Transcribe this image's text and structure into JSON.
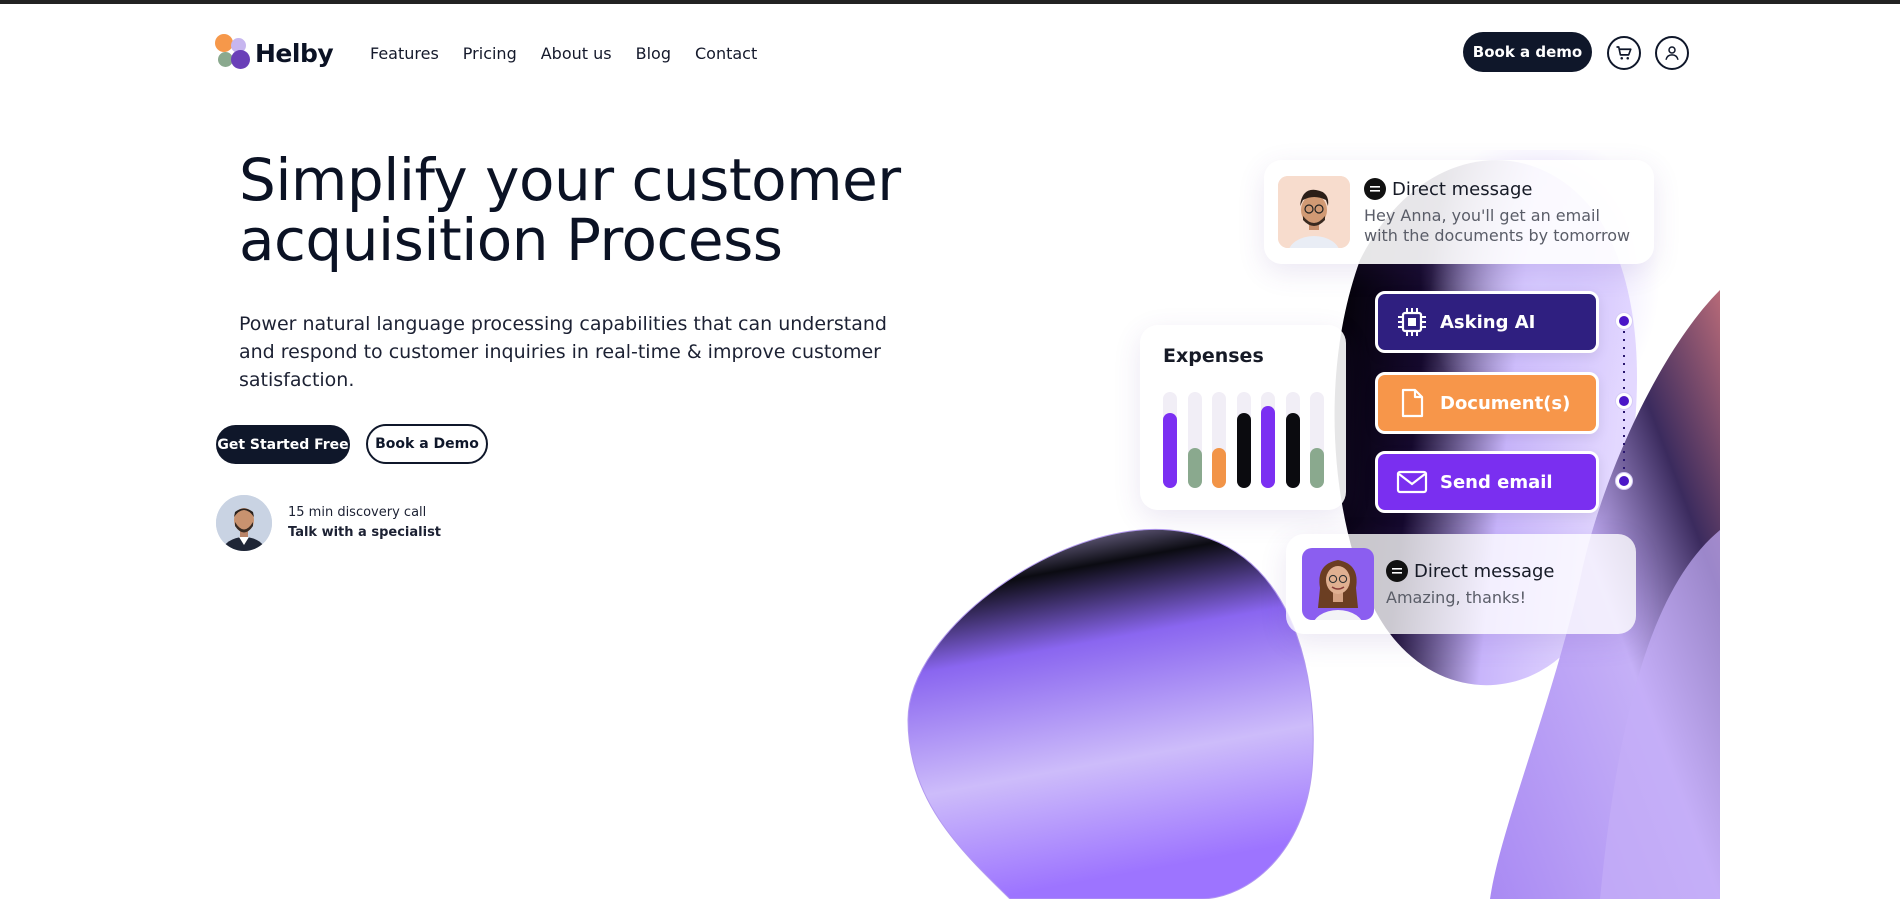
{
  "brand": {
    "name": "Helby",
    "colors": {
      "orange": "#f6984a",
      "lavender": "#c7b6ef",
      "sage": "#8aa98e",
      "purple": "#6a3fb8"
    }
  },
  "nav": {
    "links": [
      "Features",
      "Pricing",
      "About us",
      "Blog",
      "Contact"
    ],
    "cta_label": "Book a demo",
    "cart_icon": "cart-icon",
    "user_icon": "user-icon"
  },
  "hero": {
    "title_line1": "Simplify your customer",
    "title_line2": "acquisition Process",
    "description": "Power natural language processing capabilities that can understand and respond to customer inquiries in real-time & improve customer satisfaction.",
    "primary_button": "Get Started Free",
    "secondary_button": "Book a Demo",
    "specialist": {
      "line1": "15 min discovery call",
      "line2_prefix": "Talk with a ",
      "line2_bold": "specialist"
    }
  },
  "illustration": {
    "message_top": {
      "title": "Direct message",
      "body": "Hey Anna, you'll get an email with the documents by tomorrow"
    },
    "expenses": {
      "title": "Expenses",
      "bars": [
        {
          "level": 0.78,
          "color": "#7b2ff2"
        },
        {
          "level": 0.42,
          "color": "#8aa98e"
        },
        {
          "level": 0.42,
          "color": "#f29447"
        },
        {
          "level": 0.78,
          "color": "#0b0b0f"
        },
        {
          "level": 0.85,
          "color": "#7b2ff2"
        },
        {
          "level": 0.78,
          "color": "#0b0b0f"
        },
        {
          "level": 0.42,
          "color": "#8aa98e"
        }
      ]
    },
    "steps": [
      {
        "label": "Asking AI",
        "color": "#2f1f80",
        "icon": "chip-icon"
      },
      {
        "label": "Document(s)",
        "color": "#f7964a",
        "icon": "document-icon"
      },
      {
        "label": "Send email",
        "color": "#7a2ff0",
        "icon": "mail-icon"
      }
    ],
    "message_bottom": {
      "title": "Direct message",
      "body": "Amazing, thanks!"
    }
  }
}
